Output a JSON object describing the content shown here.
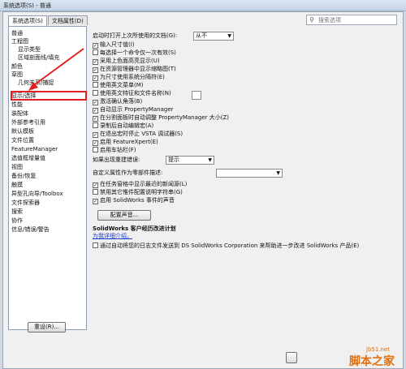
{
  "window": {
    "title": "系统选项(S) - 普通"
  },
  "tabs": [
    {
      "label": "系统选项(S)"
    },
    {
      "label": "文档属性(D)"
    }
  ],
  "search": {
    "placeholder": "搜索选项"
  },
  "tree": {
    "items": [
      {
        "label": "普通"
      },
      {
        "label": "工程图"
      },
      {
        "label": "显示类型"
      },
      {
        "label": "区域剖面线/填充"
      },
      {
        "label": "颜色"
      },
      {
        "label": "草图"
      },
      {
        "label": "几何关系/捕捉"
      },
      {
        "label": "显示/选择"
      },
      {
        "label": "性能"
      },
      {
        "label": "装配体"
      },
      {
        "label": "外部参考引用"
      },
      {
        "label": "默认模板"
      },
      {
        "label": "文件位置"
      },
      {
        "label": "FeatureManager"
      },
      {
        "label": "选值框增量值"
      },
      {
        "label": "视图"
      },
      {
        "label": "备份/恢复"
      },
      {
        "label": "触摸"
      },
      {
        "label": "异型孔向导/Toolbox"
      },
      {
        "label": "文件探索器"
      },
      {
        "label": "搜索"
      },
      {
        "label": "协作"
      },
      {
        "label": "信息/错误/警告"
      }
    ],
    "highlight_color": "#e02020",
    "reset_label": "重设(R)..."
  },
  "options": {
    "open_last_docs_label": "启动时打开上次所使用的文档(G):",
    "open_last_docs_value": "从不",
    "checkboxes": [
      {
        "label": "输入尺寸值(I)",
        "checked": true
      },
      {
        "label": "每选择一个命令仅一次有效(S)",
        "checked": false
      },
      {
        "label": "采用上色面高亮显示(U)",
        "checked": true
      },
      {
        "label": "在资源管理器中显示缩略图(T)",
        "checked": true
      },
      {
        "label": "为尺寸使用系统分隔符(E)",
        "checked": true
      },
      {
        "label": "使用英文菜单(M)",
        "checked": false
      },
      {
        "label": "使用英文特征和文件名称(N)",
        "checked": false
      },
      {
        "label": "激活确认角落(B)",
        "checked": true
      },
      {
        "label": "自动显示 PropertyManager",
        "checked": true
      },
      {
        "label": "在分割面板时自动调整 PropertyManager 大小(Z)",
        "checked": true
      },
      {
        "label": "录制后自动编辑宏(A)",
        "checked": false
      },
      {
        "label": "在退出宏时停止 VSTA 调试器(S)",
        "checked": true
      },
      {
        "label": "启用 FeatureXpert(E)",
        "checked": true
      },
      {
        "label": "启用车钻栏(F)",
        "checked": false
      }
    ],
    "rebuild_error_label": "如果出现重建错误:",
    "rebuild_error_value": "提示",
    "custom_prop_label": "自定义属性作为零部件描述:",
    "custom_prop_value": "",
    "checkboxes2": [
      {
        "label": "在任务窗格中显示最近的新闻源(L)",
        "checked": true
      },
      {
        "label": "禁用其它惟件配置说明字符串(G)",
        "checked": false
      },
      {
        "label": "启用 SolidWorks 事件的声音",
        "checked": true
      }
    ],
    "sound_button": "配置声音...",
    "ceip_title": "SolidWorks 客户经历改进计划",
    "ceip_link": "为我详细介绍。",
    "ceip_checkbox": "通过自动将您的日志文件发送到 DS SolidWorks Corporation 来帮助进一步改进 SolidWorks 产品(E)",
    "ceip_checked": false
  },
  "watermark": {
    "site": "jb51.net",
    "name": "脚本之家"
  }
}
